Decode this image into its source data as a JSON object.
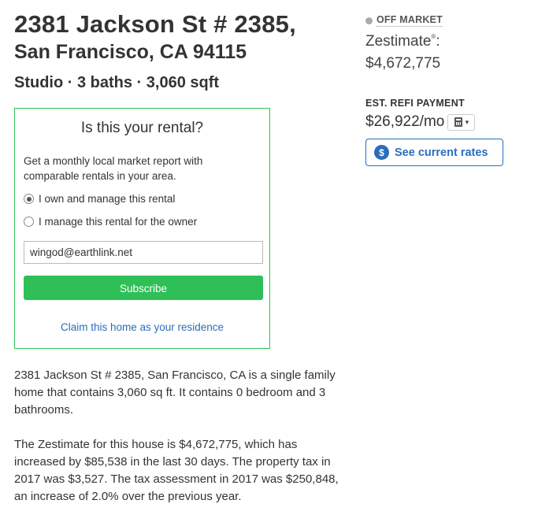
{
  "property": {
    "address_line1": "2381 Jackson St # 2385,",
    "address_line2": "San Francisco, CA 94115",
    "facts": "Studio · 3 baths · 3,060 sqft"
  },
  "rental_form": {
    "title": "Is this your rental?",
    "description": "Get a monthly local market report with comparable rentals in your area.",
    "options": [
      {
        "label": "I own and manage this rental",
        "checked": true
      },
      {
        "label": "I manage this rental for the owner",
        "checked": false
      }
    ],
    "email_value": "wingod@earthlink.net",
    "subscribe_label": "Subscribe",
    "claim_link": "Claim this home as your residence"
  },
  "description": {
    "paragraph1": "2381 Jackson St # 2385, San Francisco, CA is a single family home that contains 3,060 sq ft. It contains 0 bedroom and 3 bathrooms.",
    "paragraph2": "The Zestimate for this house is $4,672,775, which has increased by $85,538 in the last 30 days. The property tax in 2017 was $3,527. The tax assessment in 2017 was $250,848, an increase of 2.0% over the previous year."
  },
  "sidebar": {
    "status": "OFF MARKET",
    "status_color": "#aaaaaa",
    "zestimate_label": "Zestimate",
    "zestimate_sup": "®",
    "zestimate_colon": ":",
    "zestimate_value": "$4,672,775",
    "refi_label": "EST. REFI PAYMENT",
    "refi_value": "$26,922/mo",
    "calculator_icon": "calculator-icon",
    "calc_caret": "▾",
    "rates_icon": "dollar-circle-icon",
    "rates_icon_glyph": "$",
    "rates_label": "See current rates"
  },
  "colors": {
    "accent_green": "#2fbf57",
    "link_blue": "#2a6ebb",
    "text": "#333333"
  }
}
